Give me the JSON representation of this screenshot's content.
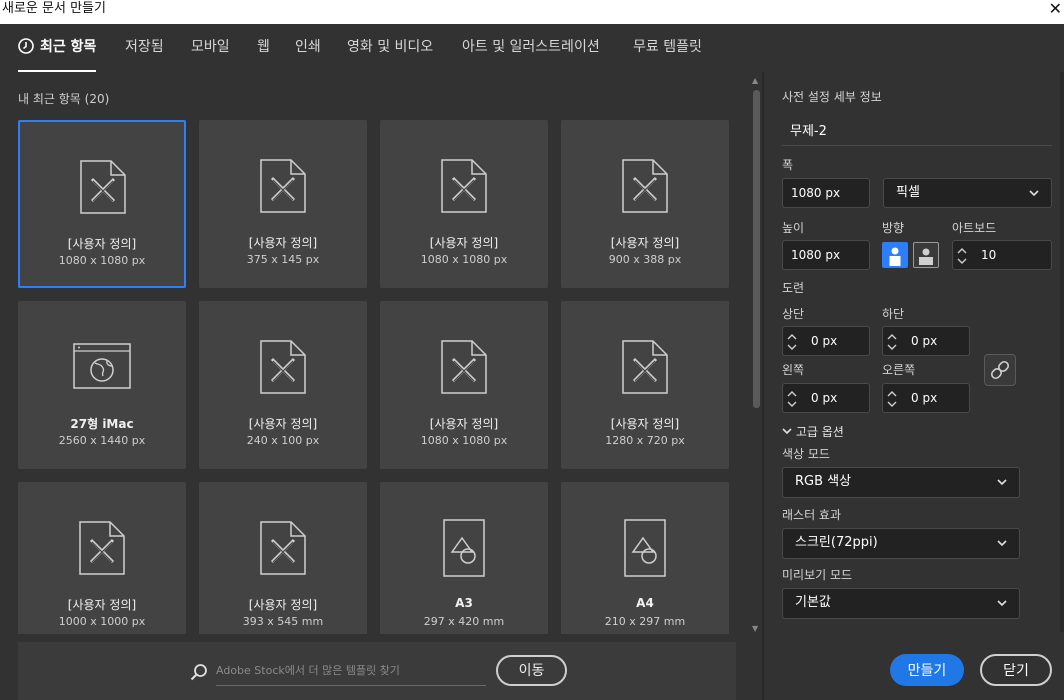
{
  "window": {
    "title": "새로운 문서 만들기",
    "close_glyph": "✕"
  },
  "tabs": [
    {
      "label": "최근 항목",
      "active": true
    },
    {
      "label": "저장됨"
    },
    {
      "label": "모바일"
    },
    {
      "label": "웹"
    },
    {
      "label": "인쇄"
    },
    {
      "label": "영화 및 비디오"
    },
    {
      "label": "아트 및 일러스트레이션"
    },
    {
      "label": "무료 템플릿"
    }
  ],
  "recent": {
    "title": "내 최근 항목  (20)",
    "items": [
      {
        "name": "[사용자 정의]",
        "size": "1080 x 1080 px",
        "icon": "custom-doc-icon",
        "selected": true
      },
      {
        "name": "[사용자 정의]",
        "size": "375 x 145 px",
        "icon": "custom-doc-icon"
      },
      {
        "name": "[사용자 정의]",
        "size": "1080 x 1080 px",
        "icon": "custom-doc-icon"
      },
      {
        "name": "[사용자 정의]",
        "size": "900 x 388 px",
        "icon": "custom-doc-icon"
      },
      {
        "name": "27형 iMac",
        "size": "2560 x 1440 px",
        "icon": "web-browser-icon"
      },
      {
        "name": "[사용자 정의]",
        "size": "240 x 100 px",
        "icon": "custom-doc-icon"
      },
      {
        "name": "[사용자 정의]",
        "size": "1080 x 1080 px",
        "icon": "custom-doc-icon"
      },
      {
        "name": "[사용자 정의]",
        "size": "1280 x 720 px",
        "icon": "custom-doc-icon"
      },
      {
        "name": "[사용자 정의]",
        "size": "1000 x 1000 px",
        "icon": "custom-doc-icon"
      },
      {
        "name": "[사용자 정의]",
        "size": "393 x 545 mm",
        "icon": "custom-doc-icon"
      },
      {
        "name": "A3",
        "size": "297 x 420 mm",
        "icon": "print-doc-icon"
      },
      {
        "name": "A4",
        "size": "210 x 297 mm",
        "icon": "print-doc-icon"
      }
    ]
  },
  "search": {
    "placeholder": "Adobe Stock에서 더 많은 템플릿 찾기",
    "go_label": "이동"
  },
  "preset": {
    "title": "사전 설정 세부 정보",
    "doc_name": "무제-2",
    "width_label": "폭",
    "width_value": "1080 px",
    "unit_value": "픽셀",
    "height_label": "높이",
    "height_value": "1080 px",
    "orientation_label": "방향",
    "artboard_label": "아트보드",
    "artboard_value": "10",
    "bleed_label": "도련",
    "top_label": "상단",
    "top_value": "0 px",
    "bottom_label": "하단",
    "bottom_value": "0 px",
    "left_label": "왼쪽",
    "left_value": "0 px",
    "right_label": "오른쪽",
    "right_value": "0 px",
    "advanced_label": "고급 옵션",
    "color_mode_label": "색상 모드",
    "color_mode_value": "RGB 색상",
    "raster_label": "래스터 효과",
    "raster_value": "스크린(72ppi)",
    "preview_label": "미리보기 모드",
    "preview_value": "기본값"
  },
  "actions": {
    "create_label": "만들기",
    "close_label": "닫기"
  },
  "colors": {
    "accent": "#2d7ff9",
    "create_button": "#1f78e6",
    "panel": "#323232",
    "card": "#434343"
  }
}
